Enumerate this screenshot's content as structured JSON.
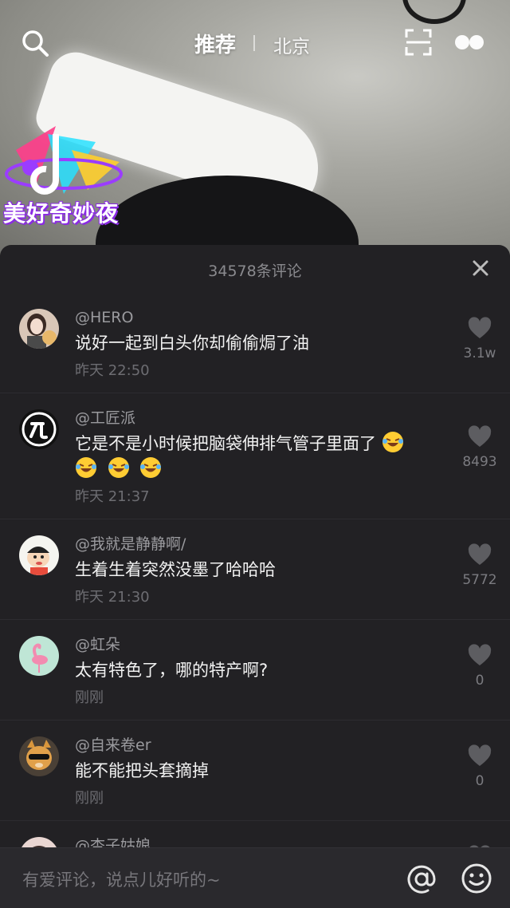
{
  "header": {
    "tab_recommend": "推荐",
    "tab_city": "北京"
  },
  "logo": {
    "text": "美好奇妙夜"
  },
  "comments_panel": {
    "title": "34578条评论",
    "comments": [
      {
        "user": "@HERO",
        "text": "说好一起到白头你却偷偷焗了油",
        "time": "昨天 22:50",
        "likes": "3.1w",
        "avatar": "girl-avatar"
      },
      {
        "user": "@工匠派",
        "text": "它是不是小时候把脑袋伸排气管子里面了",
        "emoji_count": 4,
        "time": "昨天 21:37",
        "likes": "8493",
        "avatar": "logo-avatar"
      },
      {
        "user": "@我就是静静啊/",
        "text": "生着生着突然没墨了哈哈哈",
        "time": "昨天 21:30",
        "likes": "5772",
        "avatar": "cartoon-avatar"
      },
      {
        "user": "@虹朵",
        "text": "太有特色了，哪的特产啊?",
        "time": "刚刚",
        "likes": "0",
        "avatar": "flamingo-avatar"
      },
      {
        "user": "@自来卷er",
        "text": "能不能把头套摘掉",
        "time": "刚刚",
        "likes": "0",
        "avatar": "cat-avatar"
      },
      {
        "user": "@杏子姑娘",
        "text": "",
        "time": "",
        "likes": "",
        "avatar": "photo-avatar"
      }
    ]
  },
  "input": {
    "placeholder": "有爱评论，说点儿好听的~"
  },
  "colors": {
    "sheet_bg": "#222124",
    "like_heart": "#5d5d61"
  }
}
